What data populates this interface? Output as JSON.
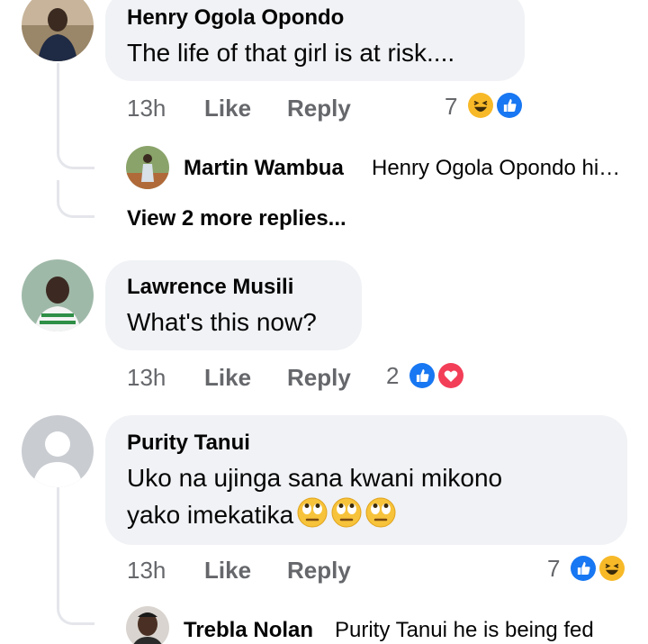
{
  "comments": [
    {
      "author": "Henry Ogola Opondo",
      "text": "The life of that girl is at risk....",
      "time": "13h",
      "like_label": "Like",
      "reply_label": "Reply",
      "reaction_count": "7",
      "reactions": [
        "haha-icon",
        "like-icon"
      ],
      "replies": [
        {
          "author": "Martin Wambua",
          "text": "Henry Ogola Opondo hi…"
        }
      ],
      "more_replies_label": "View 2 more replies..."
    },
    {
      "author": "Lawrence Musili",
      "text": "What's this now?",
      "time": "13h",
      "like_label": "Like",
      "reply_label": "Reply",
      "reaction_count": "2",
      "reactions": [
        "like-icon",
        "love-icon"
      ]
    },
    {
      "author": "Purity Tanui",
      "text_line1": "Uko na ujinga sana kwani mikono",
      "text_line2": "yako imekatika",
      "emoji": [
        "face-with-rolling-eyes-icon",
        "face-with-rolling-eyes-icon",
        "face-with-rolling-eyes-icon"
      ],
      "time": "13h",
      "like_label": "Like",
      "reply_label": "Reply",
      "reaction_count": "7",
      "reactions": [
        "like-icon",
        "haha-icon"
      ],
      "replies": [
        {
          "author": "Trebla Nolan",
          "text": "Purity Tanui he is being fed"
        }
      ]
    }
  ],
  "colors": {
    "bubble": "#f0f2f5",
    "meta_text": "#65676b",
    "like_blue": "#1877f2",
    "love_red": "#f33e58",
    "haha_yellow": "#f7b928",
    "thread_line": "#e4e6eb"
  }
}
